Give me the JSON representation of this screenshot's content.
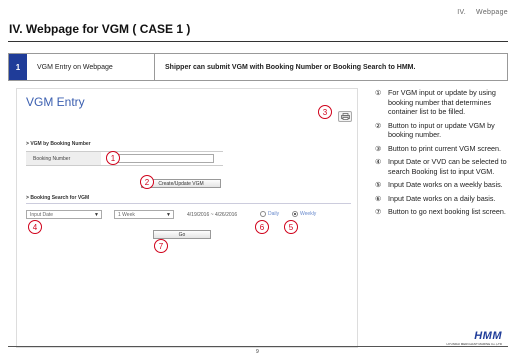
{
  "header": {
    "section": "IV.",
    "section_name": "Webpage",
    "title": "IV.   Webpage for VGM ( CASE 1 )"
  },
  "info_bar": {
    "number": "1",
    "name": "VGM Entry on Webpage",
    "description": "Shipper can submit VGM with Booking Number or Booking Search to HMM."
  },
  "screen": {
    "title": "VGM Entry",
    "by_booking": {
      "label": "VGM by Booking Number",
      "field_label": "Booking Number",
      "field_value": "",
      "button": "Create/Update VGM"
    },
    "booking_search": {
      "label": "Booking Search for VGM",
      "input_type": "Input Date",
      "period": "1 Week",
      "date_range": "4/19/2016 ~ 4/26/2016",
      "radio_daily": "Daily",
      "radio_weekly": "Weekly",
      "selected": "Weekly",
      "go_button": "Go"
    }
  },
  "callouts": [
    "1",
    "2",
    "3",
    "4",
    "5",
    "6",
    "7"
  ],
  "notes": [
    {
      "marker": "①",
      "text": "For VGM input or update by using booking number that determines container list to be filled."
    },
    {
      "marker": "②",
      "text": "Button to input or update VGM by booking number."
    },
    {
      "marker": "③",
      "text": "Button to print current VGM screen."
    },
    {
      "marker": "④",
      "text": "Input Date or VVD can be selected to search Booking list to input VGM."
    },
    {
      "marker": "⑤",
      "text": "Input Date works on a weekly basis."
    },
    {
      "marker": "⑥",
      "text": "Input Date works on a daily basis."
    },
    {
      "marker": "⑦",
      "text": "Button to go next booking list screen."
    }
  ],
  "footer": {
    "page": "9",
    "logo": "HMM",
    "logo_sub": "HYUNDAI MERCHANT MARINE Co.,LTD"
  },
  "colors": {
    "accent_blue": "#1f3c99",
    "callout_red": "#d0021b",
    "title_blue": "#3b5fb0"
  }
}
